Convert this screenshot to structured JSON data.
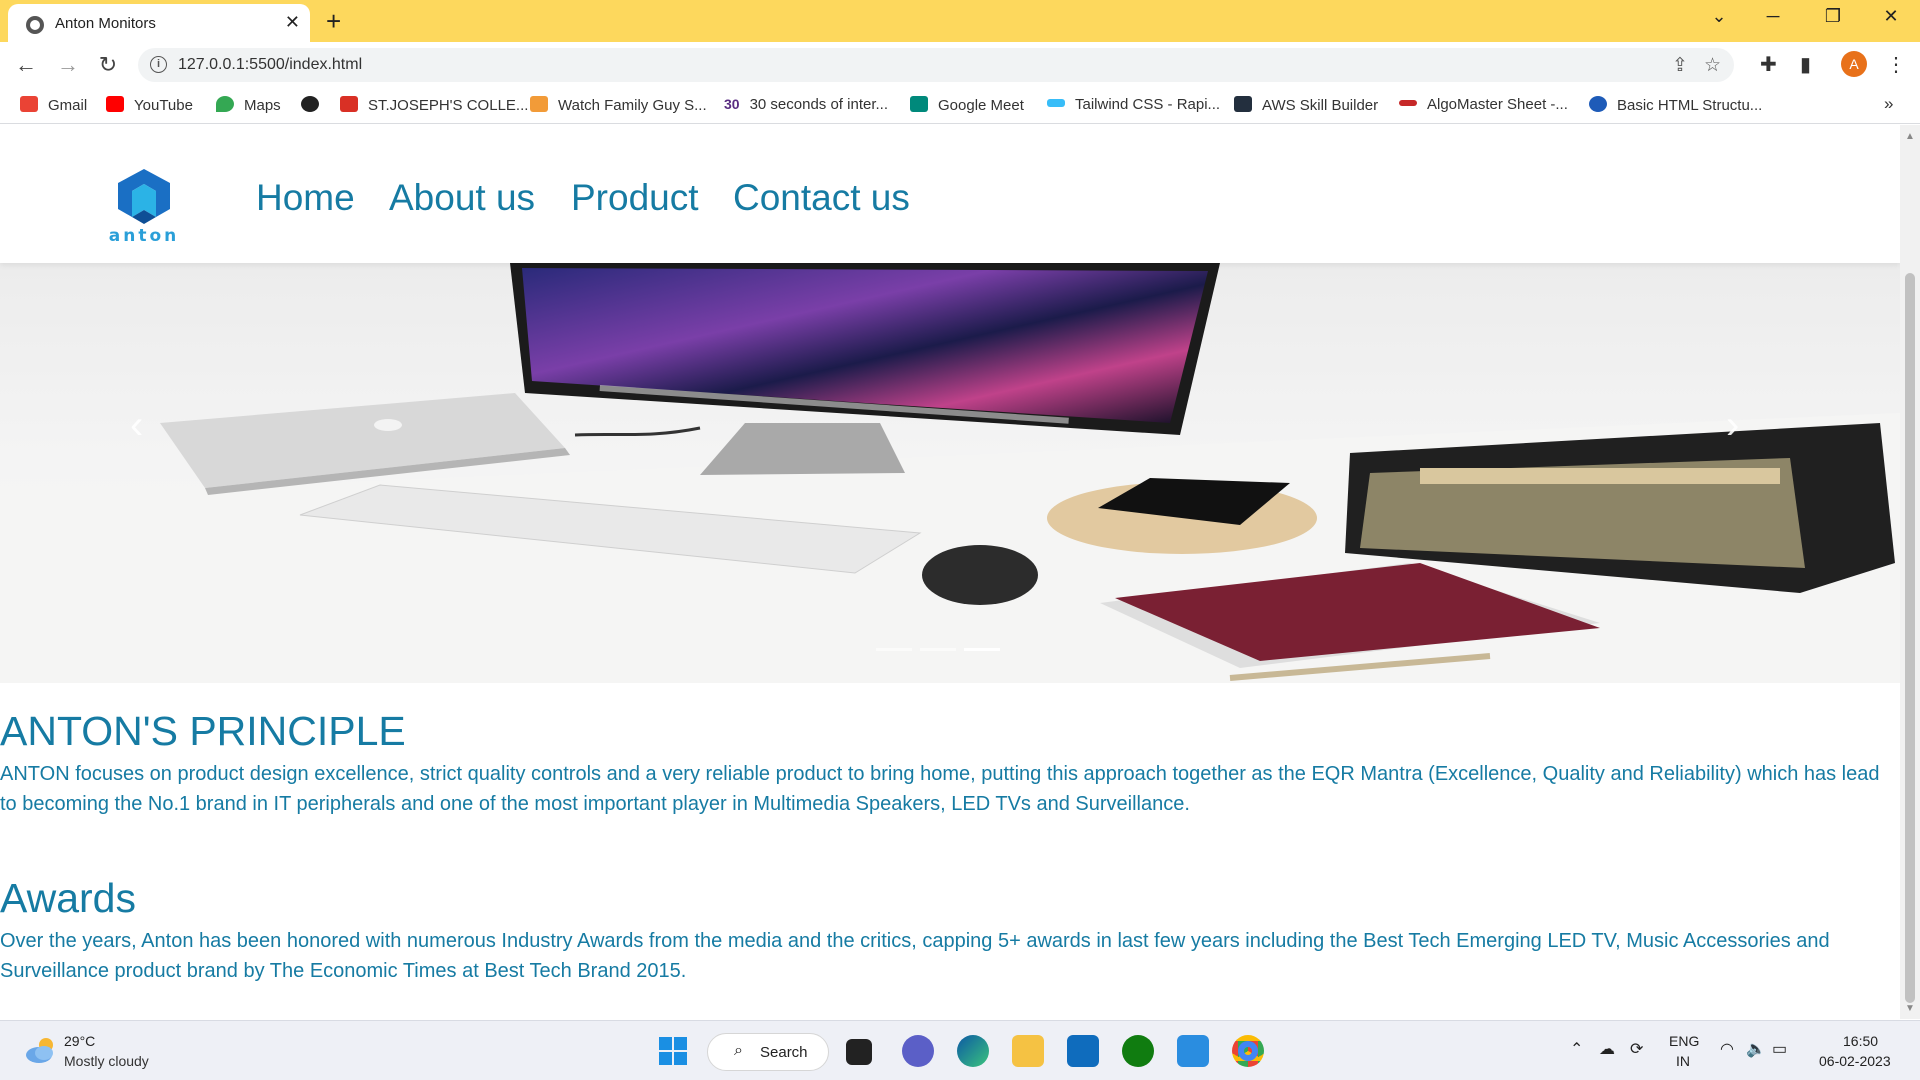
{
  "browser": {
    "tab_title": "Anton Monitors",
    "url": "127.0.0.1:5500/index.html",
    "profile_initial": "A",
    "bookmarks": [
      {
        "label": "Gmail",
        "color": "#ea4335"
      },
      {
        "label": "YouTube",
        "color": "#ff0000"
      },
      {
        "label": "Maps",
        "color": "#34a853"
      },
      {
        "label": "",
        "color": "#222222"
      },
      {
        "label": "ST.JOSEPH'S COLLE...",
        "color": "#d93025"
      },
      {
        "label": "Watch Family Guy S...",
        "color": "#f29b38"
      },
      {
        "label": "30 seconds of inter...",
        "color": "#5a2d82"
      },
      {
        "label": "Google Meet",
        "color": "#00897b"
      },
      {
        "label": "Tailwind CSS - Rapi...",
        "color": "#38bdf8"
      },
      {
        "label": "AWS Skill Builder",
        "color": "#232f3e"
      },
      {
        "label": "AlgoMaster Sheet -...",
        "color": "#c62828"
      },
      {
        "label": "Basic HTML Structu...",
        "color": "#1e5bb8"
      }
    ],
    "bookmark_30_badge": "30",
    "overflow": "»"
  },
  "site": {
    "nav": [
      "Home",
      "About us",
      "Product",
      "Contact us"
    ],
    "logo_text": "anton"
  },
  "principle": {
    "title": "ANTON'S PRINCIPLE",
    "body": "ANTON focuses on product design excellence, strict quality controls and a very reliable product to bring home, putting this approach together as the EQR Mantra (Excellence, Quality and Reliability) which has lead to becoming the No.1 brand in IT peripherals and one of the most important player in Multimedia Speakers, LED TVs and Surveillance."
  },
  "awards": {
    "title": "Awards",
    "body": "Over the years, Anton has been honored with numerous Industry Awards from the media and the critics, capping 5+ awards in last few years including the Best Tech Emerging LED TV, Music Accessories and Surveillance product brand by The Economic Times at Best Tech Brand 2015."
  },
  "carousel": {
    "prev_glyph": "‹",
    "next_glyph": "›",
    "active_index": 2,
    "slide_count": 3
  },
  "taskbar": {
    "temperature": "29°C",
    "weather": "Mostly cloudy",
    "search_label": "Search",
    "lang_top": "ENG",
    "lang_bottom": "IN",
    "time": "16:50",
    "date": "06-02-2023"
  },
  "colors": {
    "accent": "#167ba3",
    "tabstrip": "#fdd85d"
  }
}
